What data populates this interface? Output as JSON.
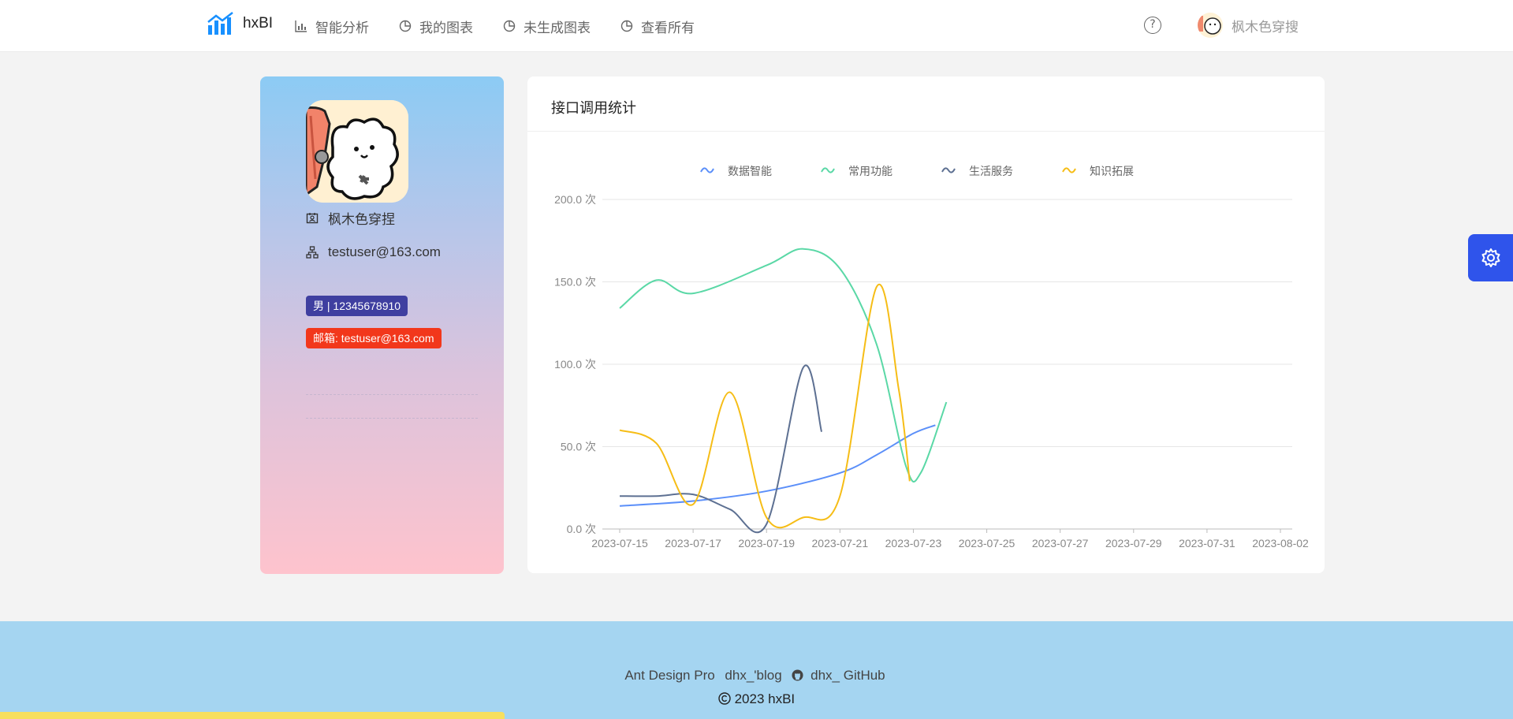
{
  "app": {
    "name": "hxBI"
  },
  "nav": {
    "items": [
      {
        "label": "智能分析",
        "icon": "bar-chart-icon"
      },
      {
        "label": "我的图表",
        "icon": "pie-chart-icon"
      },
      {
        "label": "未生成图表",
        "icon": "pie-chart-icon"
      },
      {
        "label": "查看所有",
        "icon": "pie-chart-icon"
      }
    ]
  },
  "header": {
    "help": "?",
    "user_name": "枫木色穿搜"
  },
  "profile": {
    "name": "枫木色穿捏",
    "email": "testuser@163.com",
    "tag_gender_phone": "男 | 12345678910",
    "tag_email": "邮箱: testuser@163.com"
  },
  "chart": {
    "title": "接口调用统计",
    "colors": {
      "数据智能": "#5b8ff9",
      "常用功能": "#5ad8a6",
      "生活服务": "#5d7092",
      "知识拓展": "#f6bd16"
    }
  },
  "chart_data": {
    "type": "line",
    "ylim": [
      0,
      200
    ],
    "yticks": [
      "0.0 次",
      "50.0 次",
      "100.0 次",
      "150.0 次",
      "200.0 次"
    ],
    "xticks": [
      "2023-07-15",
      "2023-07-17",
      "2023-07-19",
      "2023-07-21",
      "2023-07-23",
      "2023-07-25",
      "2023-07-27",
      "2023-07-29",
      "2023-07-31",
      "2023-08-02"
    ],
    "legend_position": "top",
    "grid": true,
    "series": [
      {
        "name": "数据智能",
        "color": "#5b8ff9",
        "points": [
          [
            "2023-07-15",
            14
          ],
          [
            "2023-07-17",
            17
          ],
          [
            "2023-07-19",
            23
          ],
          [
            "2023-07-21",
            34
          ],
          [
            "2023-07-22",
            45
          ],
          [
            "2023-07-23",
            58
          ],
          [
            "2023-07-23.6",
            63
          ]
        ]
      },
      {
        "name": "常用功能",
        "color": "#5ad8a6",
        "points": [
          [
            "2023-07-15",
            134
          ],
          [
            "2023-07-16",
            151
          ],
          [
            "2023-07-17",
            143
          ],
          [
            "2023-07-19",
            160
          ],
          [
            "2023-07-20",
            170
          ],
          [
            "2023-07-21",
            158
          ],
          [
            "2023-07-22",
            112
          ],
          [
            "2023-07-22.8",
            38
          ],
          [
            "2023-07-23.2",
            34
          ],
          [
            "2023-07-23.9",
            77
          ]
        ]
      },
      {
        "name": "生活服务",
        "color": "#5d7092",
        "points": [
          [
            "2023-07-15",
            20
          ],
          [
            "2023-07-16",
            20
          ],
          [
            "2023-07-17",
            21
          ],
          [
            "2023-07-18",
            12
          ],
          [
            "2023-07-19",
            3
          ],
          [
            "2023-07-20",
            98
          ],
          [
            "2023-07-20.5",
            59
          ]
        ]
      },
      {
        "name": "知识拓展",
        "color": "#f6bd16",
        "points": [
          [
            "2023-07-15",
            60
          ],
          [
            "2023-07-16",
            52
          ],
          [
            "2023-07-17",
            15
          ],
          [
            "2023-07-18",
            83
          ],
          [
            "2023-07-19",
            7
          ],
          [
            "2023-07-20",
            7
          ],
          [
            "2023-07-21",
            20
          ],
          [
            "2023-07-22",
            147
          ],
          [
            "2023-07-22.6",
            85
          ],
          [
            "2023-07-22.9",
            29
          ]
        ]
      }
    ]
  },
  "footer": {
    "link1": "Ant Design Pro",
    "link2": "dhx_'blog",
    "link3": "dhx_ GitHub",
    "copyright": "2023 hxBI"
  }
}
